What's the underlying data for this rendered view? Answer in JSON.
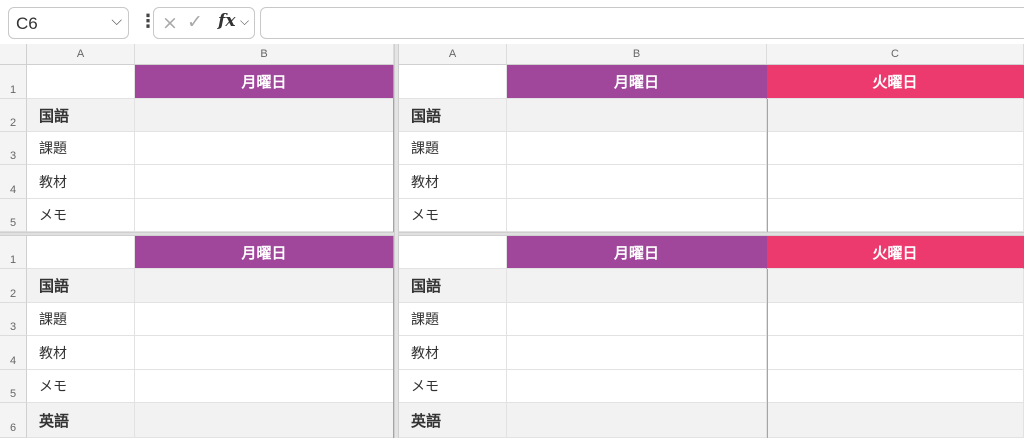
{
  "formula_bar": {
    "name_box": "C6",
    "cancel_icon": "×",
    "enter_icon": "✓",
    "fx_label": "fx",
    "formula_value": ""
  },
  "column_headers": {
    "a": "A",
    "b": "B",
    "c": "C"
  },
  "header_labels": {
    "monday": "月曜日",
    "tuesday": "火曜日"
  },
  "rows_top": [
    "1",
    "2",
    "3",
    "4",
    "5"
  ],
  "rows_bottom": [
    "1",
    "2",
    "3",
    "4",
    "5",
    "6"
  ],
  "row_labels": {
    "kokugo": "国語",
    "kadai": "課題",
    "kyouzai": "教材",
    "memo": "メモ",
    "eigo": "英語"
  },
  "colors": {
    "monday_header": "#a0479c",
    "tuesday_header": "#ec3a6e",
    "shaded_row": "#f2f2f2"
  }
}
